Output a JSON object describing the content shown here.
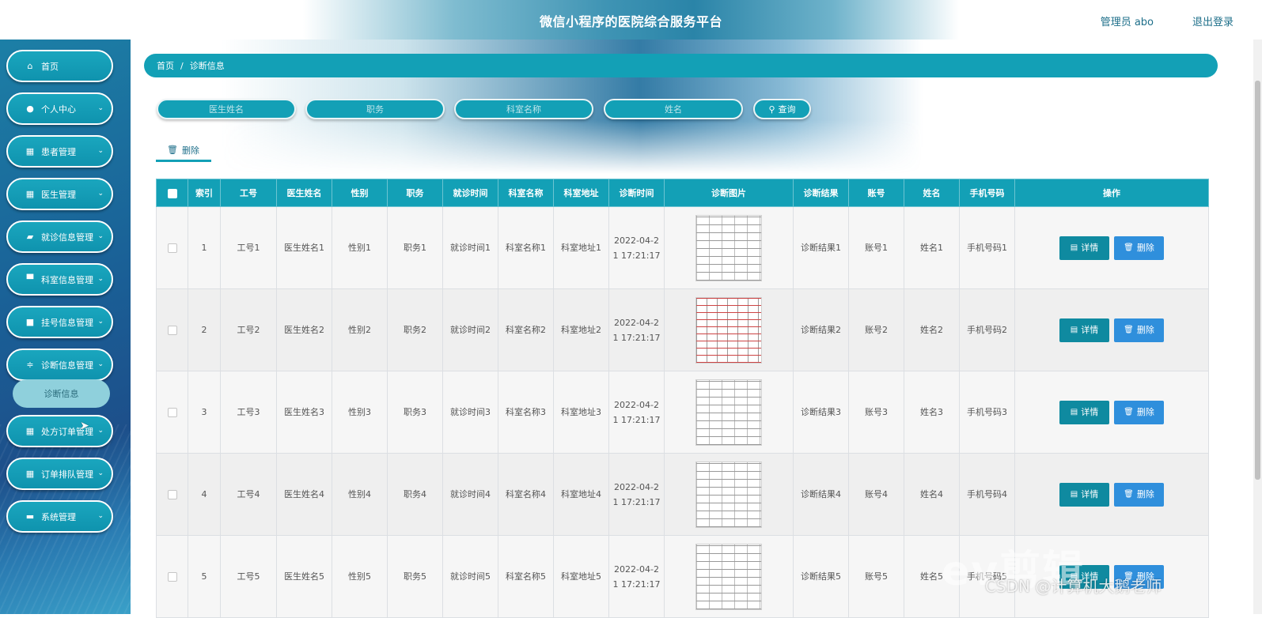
{
  "header": {
    "title": "微信小程序的医院综合服务平台",
    "admin_label": "管理员 abo",
    "logout_label": "退出登录"
  },
  "sidebar": {
    "items": [
      {
        "label": "首页",
        "icon": "home-icon"
      },
      {
        "label": "个人中心",
        "icon": "user-icon"
      },
      {
        "label": "患者管理",
        "icon": "grid-icon"
      },
      {
        "label": "医生管理",
        "icon": "grid-icon"
      },
      {
        "label": "就诊信息管理",
        "icon": "thumb-icon"
      },
      {
        "label": "科室信息管理",
        "icon": "flag-icon"
      },
      {
        "label": "挂号信息管理",
        "icon": "folder-icon"
      },
      {
        "label": "诊断信息管理",
        "icon": "sliders-icon"
      },
      {
        "label": "处方订单管理",
        "icon": "table-icon"
      },
      {
        "label": "订单排队管理",
        "icon": "grid-icon"
      },
      {
        "label": "系统管理",
        "icon": "briefcase-icon"
      }
    ],
    "active_submenu": "诊断信息"
  },
  "breadcrumb": {
    "home": "首页",
    "separator": "/",
    "current": "诊断信息"
  },
  "search": {
    "doctor_name_placeholder": "医生姓名",
    "position_placeholder": "职务",
    "department_placeholder": "科室名称",
    "name_placeholder": "姓名",
    "query_label": "查询"
  },
  "toolbar": {
    "delete_label": "删除"
  },
  "table": {
    "headers": [
      "索引",
      "工号",
      "医生姓名",
      "性别",
      "职务",
      "就诊时间",
      "科室名称",
      "科室地址",
      "诊断时间",
      "诊断图片",
      "诊断结果",
      "账号",
      "姓名",
      "手机号码",
      "操作"
    ],
    "rows": [
      {
        "index": "1",
        "emp_no": "工号1",
        "doctor": "医生姓名1",
        "gender": "性别1",
        "position": "职务1",
        "visit_time": "就诊时间1",
        "department": "科室名称1",
        "dept_address": "科室地址1",
        "diag_time": "2022-04-21 17:21:17",
        "result": "诊断结果1",
        "account": "账号1",
        "name": "姓名1",
        "phone": "手机号码1"
      },
      {
        "index": "2",
        "emp_no": "工号2",
        "doctor": "医生姓名2",
        "gender": "性别2",
        "position": "职务2",
        "visit_time": "就诊时间2",
        "department": "科室名称2",
        "dept_address": "科室地址2",
        "diag_time": "2022-04-21 17:21:17",
        "result": "诊断结果2",
        "account": "账号2",
        "name": "姓名2",
        "phone": "手机号码2"
      },
      {
        "index": "3",
        "emp_no": "工号3",
        "doctor": "医生姓名3",
        "gender": "性别3",
        "position": "职务3",
        "visit_time": "就诊时间3",
        "department": "科室名称3",
        "dept_address": "科室地址3",
        "diag_time": "2022-04-21 17:21:17",
        "result": "诊断结果3",
        "account": "账号3",
        "name": "姓名3",
        "phone": "手机号码3"
      },
      {
        "index": "4",
        "emp_no": "工号4",
        "doctor": "医生姓名4",
        "gender": "性别4",
        "position": "职务4",
        "visit_time": "就诊时间4",
        "department": "科室名称4",
        "dept_address": "科室地址4",
        "diag_time": "2022-04-21 17:21:17",
        "result": "诊断结果4",
        "account": "账号4",
        "name": "姓名4",
        "phone": "手机号码4"
      },
      {
        "index": "5",
        "emp_no": "工号5",
        "doctor": "医生姓名5",
        "gender": "性别5",
        "position": "职务5",
        "visit_time": "就诊时间5",
        "department": "科室名称5",
        "dept_address": "科室地址5",
        "diag_time": "2022-04-21 17:21:17",
        "result": "诊断结果5",
        "account": "账号5",
        "name": "姓名5",
        "phone": "手机号码5"
      }
    ],
    "detail_label": "详情",
    "delete_label": "删除"
  },
  "watermark": {
    "logo": "ev剪辑",
    "text": "CSDN @计算机大鹅老师"
  },
  "colors": {
    "accent": "#13a0b6",
    "detail_button": "#0f8aa0",
    "delete_button": "#2f8fdc",
    "header_text": "#1e6f8a"
  }
}
